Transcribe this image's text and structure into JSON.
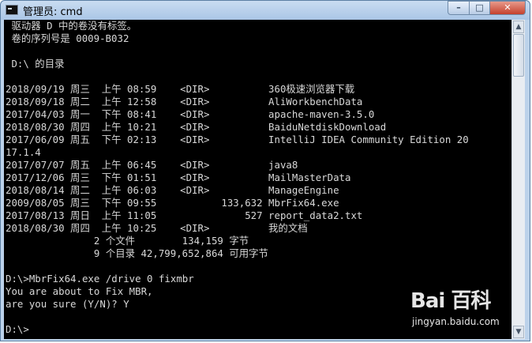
{
  "window": {
    "title": "管理员: cmd",
    "buttons": {
      "minimize": "–",
      "maximize": "□",
      "close": "✕"
    }
  },
  "console": {
    "lines": [
      " 驱动器 D 中的卷没有标签。",
      " 卷的序列号是 0009-B032",
      "",
      " D:\\ 的目录",
      "",
      "2018/09/19 周三  上午 08:59    <DIR>          360极速浏览器下载",
      "2018/09/18 周二  上午 12:58    <DIR>          AliWorkbenchData",
      "2017/04/03 周一  下午 08:41    <DIR>          apache-maven-3.5.0",
      "2018/08/30 周四  上午 10:21    <DIR>          BaiduNetdiskDownload",
      "2017/06/09 周五  下午 02:13    <DIR>          IntelliJ IDEA Community Edition 20",
      "17.1.4",
      "2017/07/07 周五  上午 06:45    <DIR>          java8",
      "2017/12/06 周三  下午 01:51    <DIR>          MailMasterData",
      "2018/08/14 周二  上午 06:03    <DIR>          ManageEngine",
      "2009/08/05 周三  下午 09:55           133,632 MbrFix64.exe",
      "2017/08/13 周日  上午 11:05               527 report_data2.txt",
      "2018/08/30 周四  上午 10:25    <DIR>          我的文档",
      "               2 个文件        134,159 字节",
      "               9 个目录 42,799,652,864 可用字节",
      "",
      "D:\\>MbrFix64.exe /drive 0 fixmbr",
      "You are about to Fix MBR,",
      "are you sure (Y/N)? Y",
      "",
      "D:\\>"
    ]
  },
  "watermark": {
    "logo": "Bai 百科",
    "site": "jingyan.baidu.com"
  }
}
